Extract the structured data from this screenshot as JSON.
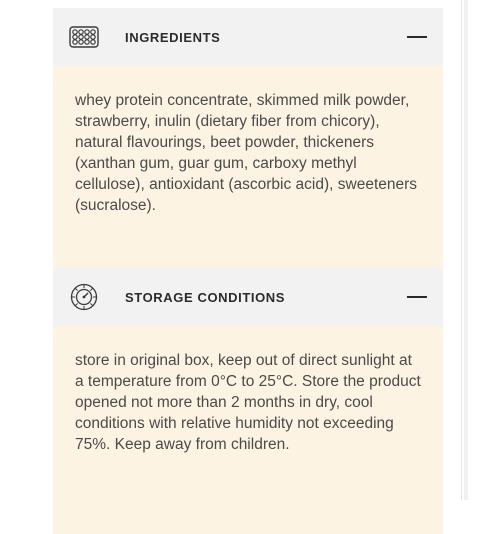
{
  "sections": [
    {
      "title": "INGREDIENTS",
      "icon": "pill-blister-icon",
      "toggle": "collapse",
      "text": "whey protein concentrate, skimmed milk powder, strawberry, inulin (dietary fiber from chicory), natural flavourings, beet powder, thickeners (xanthan gum, guar gum, carboxy methyl cellulose), antioxidant (ascorbic acid), sweeteners (sucralose)."
    },
    {
      "title": "STORAGE CONDITIONS",
      "icon": "temperature-dial-icon",
      "toggle": "collapse",
      "text": "store in original box, keep out of direct sunlight at a temperature from 0°C to 25°C. Store the product opened not more than 2 months in dry, cool conditions with relative humidity not exceeding 75%. Keep away from children."
    }
  ],
  "colors": {
    "header_bg": "#f2f2f2",
    "body_bg": "#fdf3e3",
    "text": "#4a4a4a"
  }
}
